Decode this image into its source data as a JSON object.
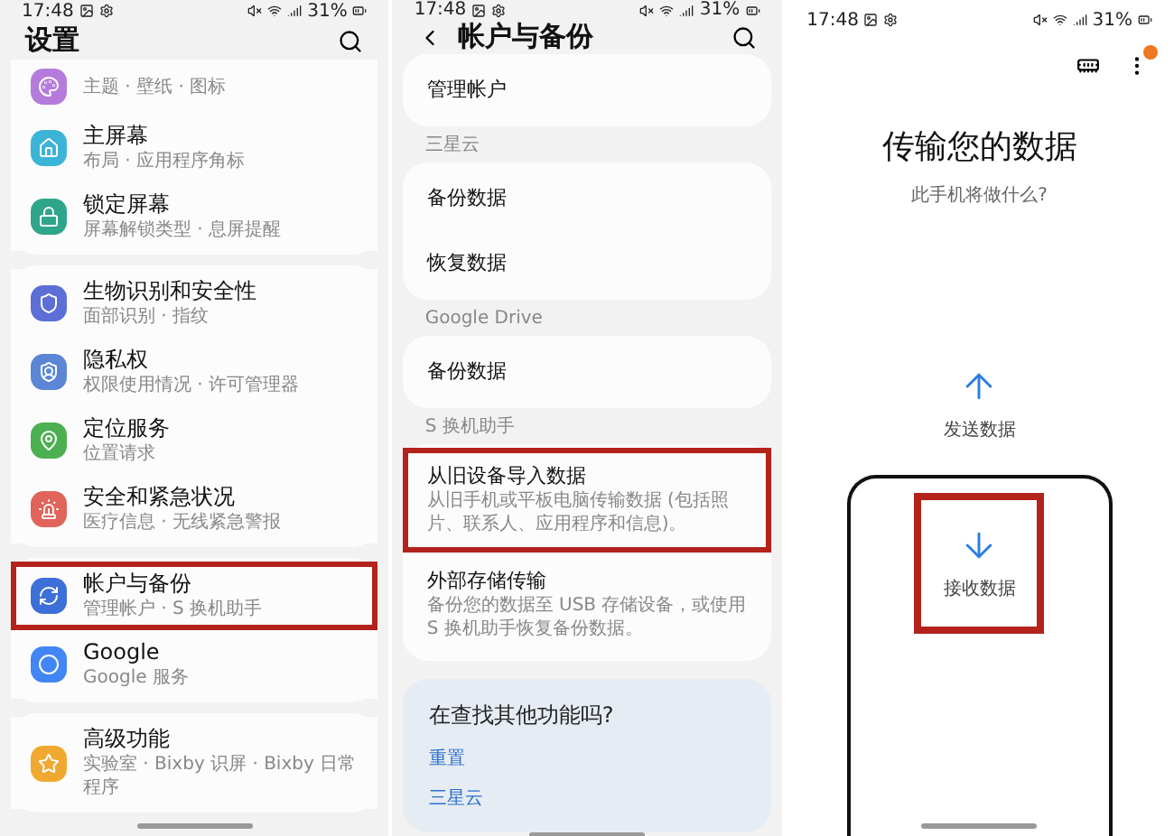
{
  "settings_screen": {
    "status_bar": {
      "time": "17:48",
      "battery": "31%"
    },
    "title": "设置",
    "groups": [
      {
        "items": [
          {
            "subtitle": "主题 · 壁纸 · 图标",
            "color": "#b57bdc",
            "highlighted": false
          },
          {
            "title": "主屏幕",
            "subtitle": "布局 · 应用程序角标",
            "color": "#3cb4d8",
            "highlighted": false
          },
          {
            "title": "锁定屏幕",
            "subtitle": "屏幕解锁类型 · 息屏提醒",
            "color": "#2fa58a",
            "highlighted": false
          }
        ]
      },
      {
        "items": [
          {
            "title": "生物识别和安全性",
            "subtitle": "面部识别 · 指纹",
            "color": "#5b6fd6",
            "highlighted": false
          },
          {
            "title": "隐私权",
            "subtitle": "权限使用情况 · 许可管理器",
            "color": "#5b86d6",
            "highlighted": false
          },
          {
            "title": "定位服务",
            "subtitle": "位置请求",
            "color": "#4caf50",
            "highlighted": false
          },
          {
            "title": "安全和紧急状况",
            "subtitle": "医疗信息 · 无线紧急警报",
            "color": "#e0645a",
            "highlighted": false
          }
        ]
      },
      {
        "items": [
          {
            "title": "帐户与备份",
            "subtitle": "管理帐户 · S 换机助手",
            "color": "#3c6fd8",
            "highlighted": true
          },
          {
            "title": "Google",
            "subtitle": "Google 服务",
            "color": "#4285f4",
            "highlighted": false
          }
        ]
      },
      {
        "items": [
          {
            "title": "高级功能",
            "subtitle": "实验室 · Bixby 识屏 · Bixby 日常程序",
            "color": "#f0a830",
            "highlighted": false
          }
        ]
      }
    ]
  },
  "accounts_screen": {
    "status_bar": {
      "time": "17:48",
      "battery": "31%"
    },
    "title": "帐户与备份",
    "sections": [
      {
        "items": [
          {
            "title": "管理帐户",
            "highlighted": false
          }
        ]
      },
      {
        "label": "三星云",
        "items": [
          {
            "title": "备份数据",
            "highlighted": false
          },
          {
            "title": "恢复数据",
            "highlighted": false
          }
        ]
      },
      {
        "label": "Google Drive",
        "items": [
          {
            "title": "备份数据",
            "highlighted": false
          }
        ]
      },
      {
        "label": "S 换机助手",
        "items": [
          {
            "title": "从旧设备导入数据",
            "description": "从旧手机或平板电脑传输数据 (包括照片、联系人、应用程序和信息)。",
            "highlighted": true
          },
          {
            "title": "外部存储传输",
            "description": "备份您的数据至 USB 存储设备，或使用 S 换机助手恢复备份数据。",
            "highlighted": false
          }
        ]
      }
    ],
    "suggestions": {
      "title": "在查找其他功能吗?",
      "links": [
        "重置",
        "三星云"
      ]
    }
  },
  "transfer_screen": {
    "status_bar": {
      "time": "17:48",
      "battery": "31%"
    },
    "title": "传输您的数据",
    "subtitle": "此手机将做什么?",
    "options": [
      {
        "kind": "send",
        "label": "发送数据",
        "highlighted": false
      },
      {
        "kind": "receive",
        "label": "接收数据",
        "highlighted": true
      }
    ]
  }
}
